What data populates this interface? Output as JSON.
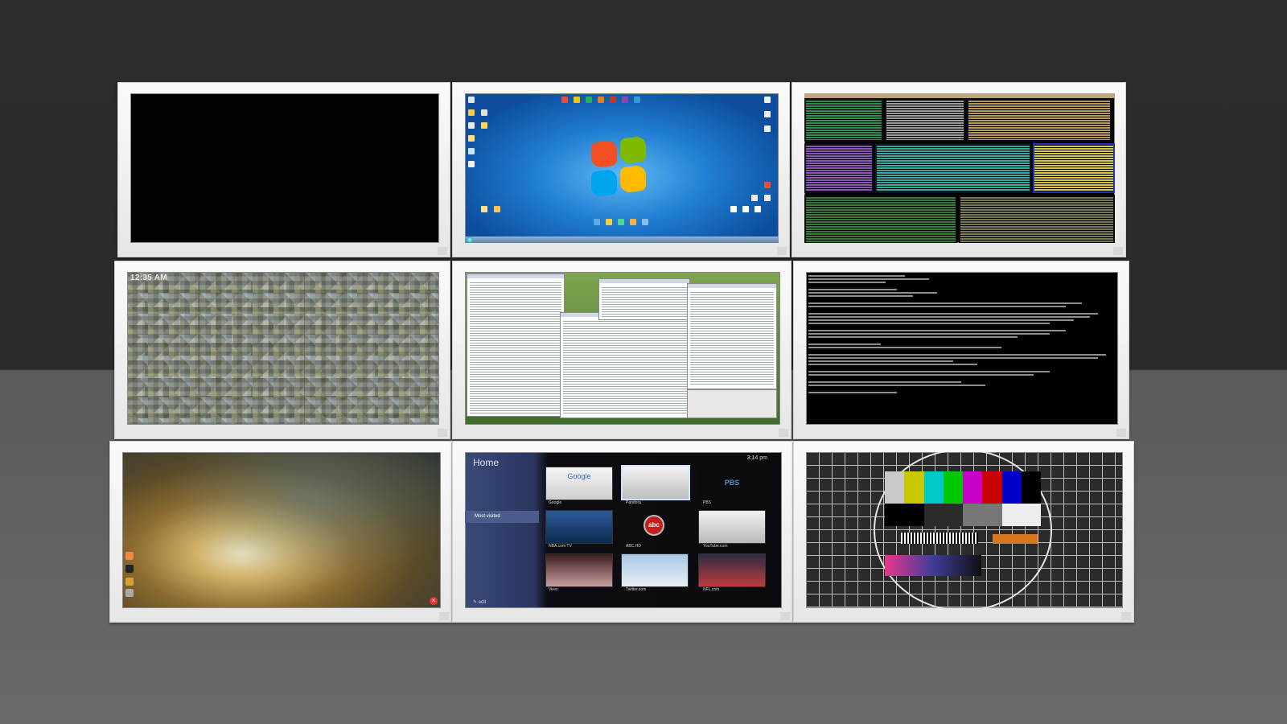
{
  "wall": {
    "screens": [
      {
        "id": "black"
      },
      {
        "id": "win7"
      },
      {
        "id": "terminals"
      },
      {
        "id": "lockscreen",
        "clock": "12:35 AM"
      },
      {
        "id": "apps"
      },
      {
        "id": "console"
      },
      {
        "id": "android"
      },
      {
        "id": "gtv"
      },
      {
        "id": "testpattern"
      }
    ]
  },
  "gtv": {
    "title": "Home",
    "time": "3:14 pm",
    "menu": [
      "",
      "",
      "",
      "Most visited",
      "",
      ""
    ],
    "selected_index": 3,
    "edit": "edit",
    "tiles": [
      {
        "label": "Google",
        "caption": "Google"
      },
      {
        "label": "",
        "caption": "Pandora"
      },
      {
        "label": "PBS",
        "caption": "PBS"
      },
      {
        "label": "",
        "caption": "NBA.com TV"
      },
      {
        "label": "abc",
        "caption": "ABC.HD"
      },
      {
        "label": "",
        "caption": "YouTube.com"
      },
      {
        "label": "",
        "caption": "Vevo"
      },
      {
        "label": "",
        "caption": "Twitter.com"
      },
      {
        "label": "",
        "caption": "NFL.com"
      }
    ]
  },
  "colors": {
    "bars": [
      "#c8c8c8",
      "#c8c800",
      "#00c8c8",
      "#00c800",
      "#c800c8",
      "#c80000",
      "#0000c8",
      "#000000"
    ],
    "row2": [
      "#000000",
      "#2b2b2b",
      "#777777",
      "#eeeeee"
    ]
  }
}
